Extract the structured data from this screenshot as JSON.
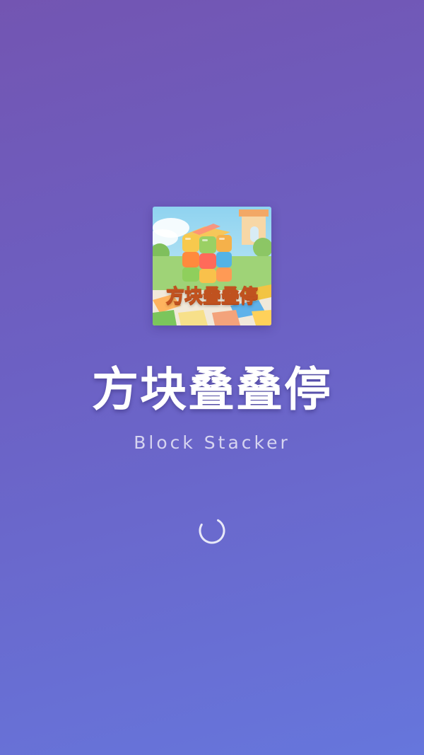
{
  "splash": {
    "app_icon": {
      "caption": "方块叠叠停",
      "icon_name": "block-stacker-cube-icon"
    },
    "title": "方块叠叠停",
    "subtitle": "Block Stacker",
    "loading_indicator": "loading-spinner-icon"
  },
  "colors": {
    "background_top": "#7355b2",
    "background_bottom": "#6676dc",
    "title": "#ffffff",
    "subtitle": "#d6d2ee",
    "spinner": "#ffffff"
  }
}
